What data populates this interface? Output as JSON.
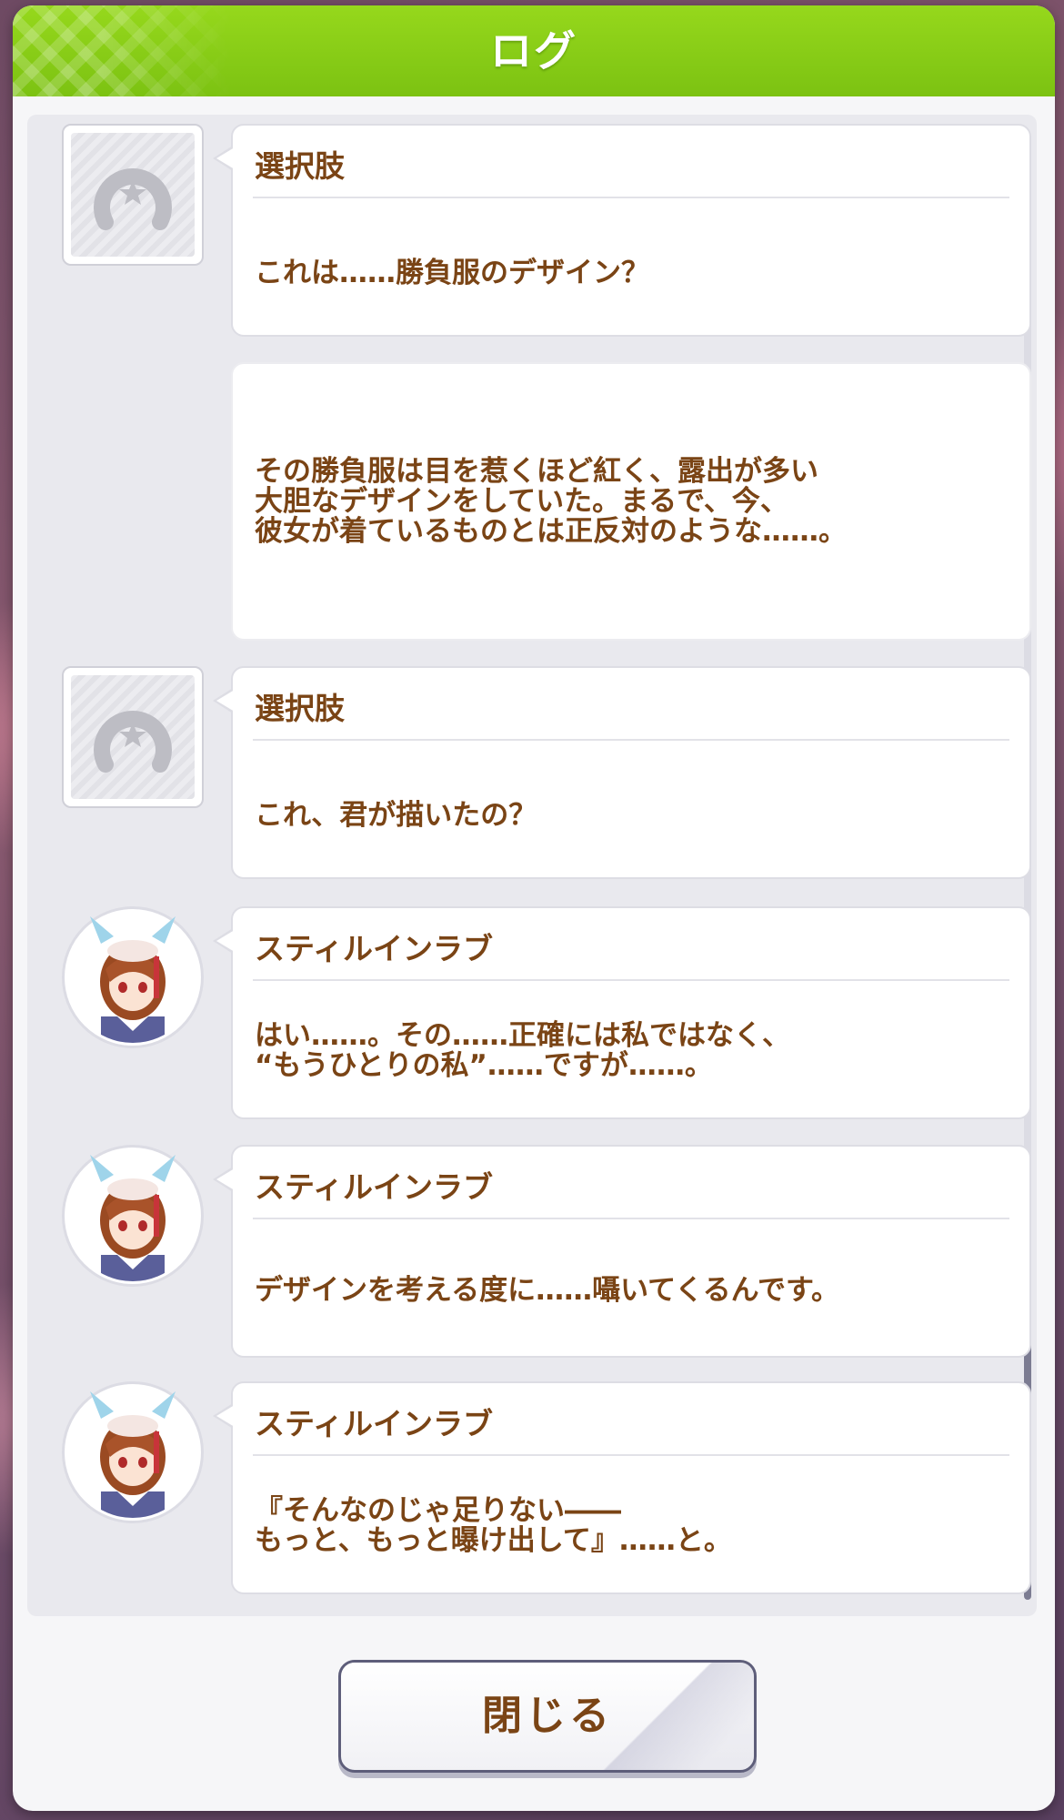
{
  "header": {
    "title": "ログ"
  },
  "log": {
    "entries": [
      {
        "type": "choice",
        "speaker": "選択肢",
        "text": "これは……勝負服のデザイン？"
      },
      {
        "type": "narration",
        "text": "その勝負服は目を惹くほど紅く、露出が多い\n大胆なデザインをしていた。まるで、今、\n彼女が着ているものとは正反対のような……。"
      },
      {
        "type": "choice",
        "speaker": "選択肢",
        "text": "これ、君が描いたの？"
      },
      {
        "type": "character",
        "speaker": "スティルインラブ",
        "text": "はい……。その……正確には私ではなく、\n“もうひとりの私”……ですが……。"
      },
      {
        "type": "character",
        "speaker": "スティルインラブ",
        "text": "デザインを考える度に……囁いてくるんです。"
      },
      {
        "type": "character",
        "speaker": "スティルインラブ",
        "text": "『そんなのじゃ足りない――\nもっと、もっと曝け出して』……と。"
      }
    ]
  },
  "footer": {
    "close_label": "閉じる"
  },
  "colors": {
    "header_green": "#8ccf18",
    "text_brown": "#7a4415"
  }
}
